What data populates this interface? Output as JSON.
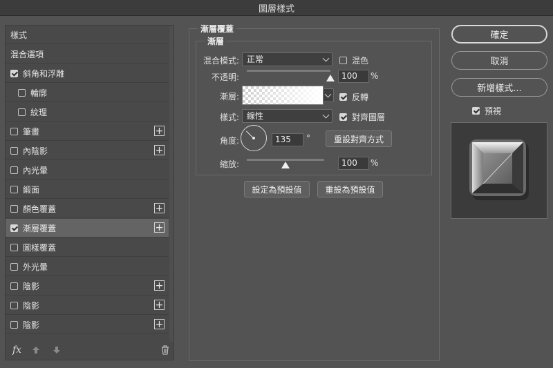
{
  "window": {
    "title": "圖層樣式"
  },
  "styles_list": {
    "items": [
      {
        "label": "樣式",
        "checkbox": false,
        "checked": false,
        "plus": false,
        "indent": false,
        "selected": false
      },
      {
        "label": "混合選項",
        "checkbox": false,
        "checked": false,
        "plus": false,
        "indent": false,
        "selected": false
      },
      {
        "label": "斜角和浮雕",
        "checkbox": true,
        "checked": true,
        "plus": false,
        "indent": false,
        "selected": false
      },
      {
        "label": "輪廓",
        "checkbox": true,
        "checked": false,
        "plus": false,
        "indent": true,
        "selected": false
      },
      {
        "label": "紋理",
        "checkbox": true,
        "checked": false,
        "plus": false,
        "indent": true,
        "selected": false
      },
      {
        "label": "筆畫",
        "checkbox": true,
        "checked": false,
        "plus": true,
        "indent": false,
        "selected": false
      },
      {
        "label": "內陰影",
        "checkbox": true,
        "checked": false,
        "plus": true,
        "indent": false,
        "selected": false
      },
      {
        "label": "內光暈",
        "checkbox": true,
        "checked": false,
        "plus": false,
        "indent": false,
        "selected": false
      },
      {
        "label": "緞面",
        "checkbox": true,
        "checked": false,
        "plus": false,
        "indent": false,
        "selected": false
      },
      {
        "label": "顏色覆蓋",
        "checkbox": true,
        "checked": false,
        "plus": true,
        "indent": false,
        "selected": false
      },
      {
        "label": "漸層覆蓋",
        "checkbox": true,
        "checked": true,
        "plus": true,
        "indent": false,
        "selected": true
      },
      {
        "label": "圖樣覆蓋",
        "checkbox": true,
        "checked": false,
        "plus": false,
        "indent": false,
        "selected": false
      },
      {
        "label": "外光暈",
        "checkbox": true,
        "checked": false,
        "plus": false,
        "indent": false,
        "selected": false
      },
      {
        "label": "陰影",
        "checkbox": true,
        "checked": false,
        "plus": true,
        "indent": false,
        "selected": false
      },
      {
        "label": "陰影",
        "checkbox": true,
        "checked": false,
        "plus": true,
        "indent": false,
        "selected": false
      },
      {
        "label": "陰影",
        "checkbox": true,
        "checked": false,
        "plus": true,
        "indent": false,
        "selected": false
      }
    ],
    "footer": {
      "fx_label": "fx",
      "icons": [
        "fx-icon",
        "move-up-icon",
        "move-down-icon",
        "trash-icon"
      ]
    }
  },
  "gradient_overlay": {
    "group_title": "漸層覆蓋",
    "subgroup_title": "漸層",
    "blend_mode_label": "混合模式:",
    "blend_mode_value": "正常",
    "dither_label": "混色",
    "dither_checked": false,
    "opacity_label": "不透明:",
    "opacity_value": "100",
    "opacity_fraction": 1.0,
    "percent_sign": "%",
    "gradient_label": "漸層:",
    "reverse_label": "反轉",
    "reverse_checked": true,
    "style_label": "樣式:",
    "style_value": "線性",
    "align_label": "對齊圖層",
    "align_checked": true,
    "angle_label": "角度:",
    "angle_value": "135",
    "degree_sign": "°",
    "reset_alignment_label": "重設對齊方式",
    "scale_label": "縮放:",
    "scale_value": "100",
    "scale_fraction": 0.5,
    "make_default_label": "設定為預設值",
    "reset_default_label": "重設為預設值"
  },
  "right_panel": {
    "ok_label": "確定",
    "cancel_label": "取消",
    "new_style_label": "新增樣式...",
    "preview_label": "預視",
    "preview_checked": true
  },
  "colors": {
    "background": "#535353",
    "panel": "#494949",
    "selected_row": "#646464",
    "titlebar": "#3c3c3c"
  }
}
